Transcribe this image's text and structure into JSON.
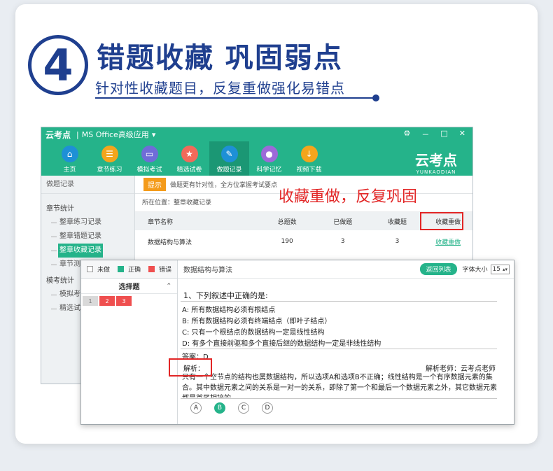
{
  "banner": {
    "number": "4",
    "headline": "错题收藏  巩固弱点",
    "subline": "针对性收藏题目，反复重做强化易错点"
  },
  "colors": {
    "brand_green": "#25b38a",
    "navy": "#1f3f8f",
    "highlight_red": "#e22626",
    "tip_orange": "#f49b1b"
  },
  "app": {
    "logo": "云考点",
    "title": "MS Office高级应用",
    "dropdown_icon": "caret-down-icon",
    "controls": [
      "⚙",
      "－",
      "□",
      "✕"
    ],
    "nav": [
      {
        "label": "主页",
        "icon": "home-icon",
        "color": "#1e90d6"
      },
      {
        "label": "章节练习",
        "icon": "list-icon",
        "color": "#f4a51c"
      },
      {
        "label": "模拟考试",
        "icon": "monitor-icon",
        "color": "#6f6cd8"
      },
      {
        "label": "精选试卷",
        "icon": "award-icon",
        "color": "#f26a5a"
      },
      {
        "label": "做题记录",
        "icon": "pencil-icon",
        "color": "#1e90d6"
      },
      {
        "label": "科学记忆",
        "icon": "brain-icon",
        "color": "#9c6ad8"
      },
      {
        "label": "视频下载",
        "icon": "download-icon",
        "color": "#f4a51c"
      }
    ],
    "brand": {
      "main": "云考点",
      "sub": "YUNKAODIAN"
    }
  },
  "sidebar": {
    "header": "做题记录",
    "group1": "章节统计",
    "group1_items": [
      "整章练习记录",
      "整章错题记录",
      "整章收藏记录",
      "章节测"
    ],
    "group2": "模考统计",
    "group2_items": [
      "模拟考",
      "精选试"
    ]
  },
  "records": {
    "tip_badge": "提示",
    "tip_text": "做题更有针对性，全方位掌握考试要点",
    "breadcrumb": "所在位置：整章收藏记录",
    "columns": [
      "章节名称",
      "总题数",
      "已做题",
      "收藏题",
      "收藏重做"
    ],
    "rows": [
      {
        "name": "数据结构与算法",
        "total": "190",
        "done": "3",
        "fav": "3",
        "action": "收藏重做"
      }
    ]
  },
  "callout": "收藏重做，反复巩固",
  "practice": {
    "legend": [
      {
        "label": "未做",
        "color": "#ffffff"
      },
      {
        "label": "正确",
        "color": "#25b38a"
      },
      {
        "label": "错误",
        "color": "#ef4f4f"
      }
    ],
    "qtype": "选择题",
    "qnums": [
      "1",
      "2",
      "3"
    ],
    "chapter": "数据结构与算法",
    "back_button": "返回列表",
    "font_size_label": "字体大小",
    "font_size_value": "15",
    "question": "1、下列叙述中正确的是:",
    "options": [
      "A: 所有数据结构必须有根结点",
      "B: 所有数据结构必须有终端结点（即叶子结点）",
      "C: 只有一个根结点的数据结构一定是线性结构",
      "D: 有多个直接前驱和多个直接后继的数据结构一定是非线性结构"
    ],
    "answer": "答案：D",
    "analysis_label": "解析：",
    "analysis_teacher": "解析老师：云考点老师",
    "analysis_text": "只有一个空节点的结构也属数据结构，所以选项A和选项B不正确；线性结构是一个有序数据元素的集合。其中数据元素之间的关系是一对一的关系，即除了第一个和最后一个数据元素之外，其它数据元素都是首尾相接的。",
    "choice_letters": [
      "A",
      "B",
      "C",
      "D"
    ],
    "selected": "B"
  }
}
